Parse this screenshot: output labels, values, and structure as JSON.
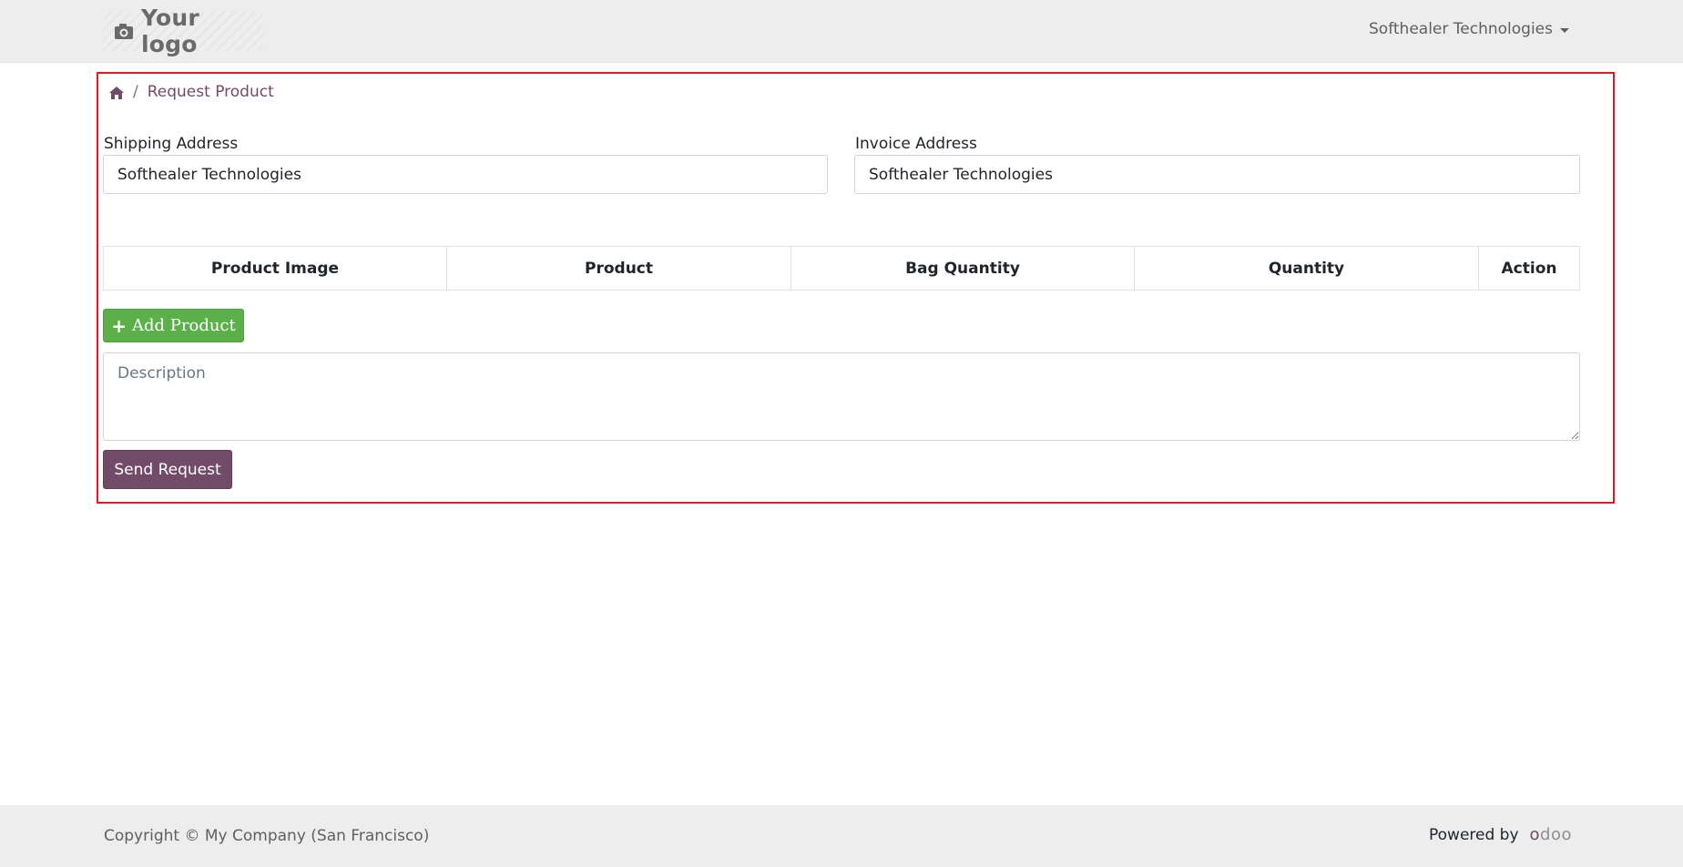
{
  "header": {
    "logo_text": "Your logo",
    "company_menu": "Softhealer Technologies"
  },
  "breadcrumb": {
    "current": "Request Product"
  },
  "form": {
    "shipping_label": "Shipping Address",
    "shipping_value": "Softhealer Technologies",
    "invoice_label": "Invoice Address",
    "invoice_value": "Softhealer Technologies",
    "table_headers": [
      "Product Image",
      "Product",
      "Bag Quantity",
      "Quantity",
      "Action"
    ],
    "add_product_label": "Add Product",
    "description_placeholder": "Description",
    "send_request_label": "Send Request"
  },
  "footer": {
    "copyright": "Copyright © My Company (San Francisco)",
    "powered_by": "Powered by",
    "odoo_first": "o",
    "odoo_rest": "doo"
  },
  "colors": {
    "brand": "#714b67",
    "success": "#5cb04a",
    "highlight_border": "#e01a22"
  }
}
